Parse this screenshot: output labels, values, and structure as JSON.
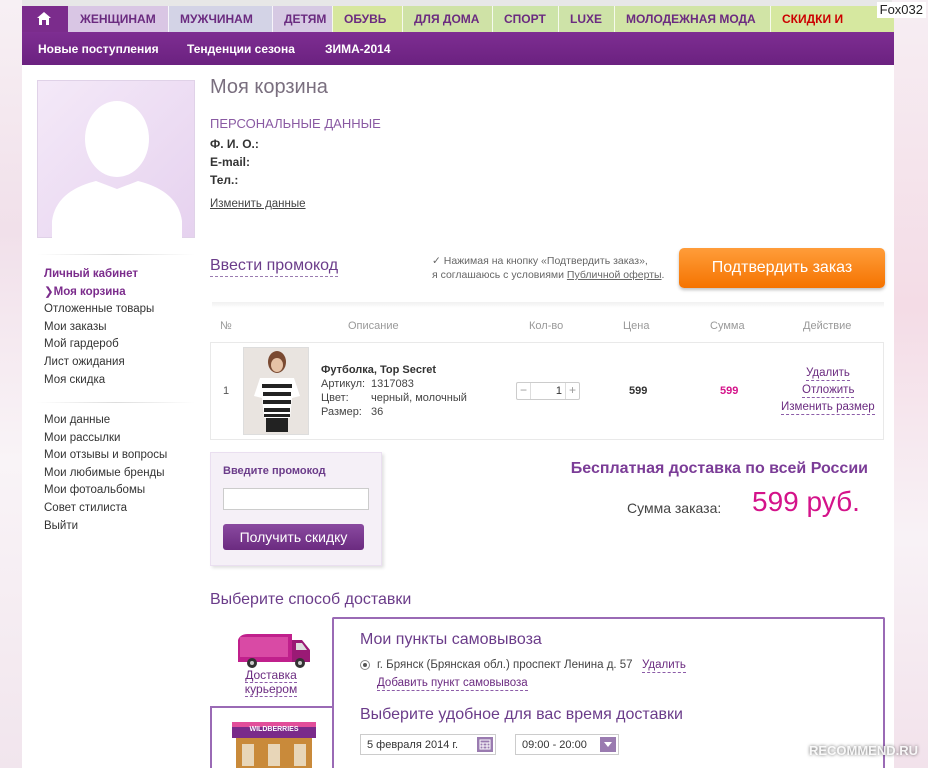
{
  "top_nav": {
    "tabs": [
      "ЖЕНЩИНАМ",
      "МУЖЧИНАМ",
      "ДЕТЯМ",
      "ОБУВЬ",
      "ДЛЯ ДОМА",
      "СПОРТ",
      "LUXE",
      "МОЛОДЕЖНАЯ МОДА",
      "СКИДКИ И АКЦИИ"
    ]
  },
  "sub_nav": [
    "Новые поступления",
    "Тенденции сезона",
    "ЗИМА-2014"
  ],
  "username": "Fox032",
  "sidebar": {
    "head": "Личный кабинет",
    "group1": [
      "Моя корзина",
      "Отложенные товары",
      "Мои заказы",
      "Мой гардероб",
      "Лист ожидания",
      "Моя скидка"
    ],
    "group2": [
      "Мои данные",
      "Мои рассылки",
      "Мои отзывы и вопросы",
      "Мои любимые бренды",
      "Мои фотоальбомы",
      "Совет стилиста",
      "Выйти"
    ]
  },
  "main": {
    "title": "Моя корзина",
    "personal_title": "ПЕРСОНАЛЬНЫЕ ДАННЫЕ",
    "fields": [
      "Ф. И. О.:",
      "E-mail:",
      "Тел.:"
    ],
    "edit_link": "Изменить данные",
    "promo_title": "Ввести промокод",
    "agree_line1": "Нажимая на кнопку «Подтвердить заказ»,",
    "agree_line2": "я соглашаюсь с условиями",
    "agree_link": "Публичной оферты",
    "agree_end": ".",
    "confirm_button": "Подтвердить заказ"
  },
  "table": {
    "headers": [
      "№",
      "Описание",
      "Кол-во",
      "Цена",
      "Сумма",
      "Действие"
    ],
    "row": {
      "num": "1",
      "name": "Футболка, Top Secret",
      "labels": [
        "Артикул:",
        "Цвет:",
        "Размер:"
      ],
      "values": [
        "1317083",
        "черный, молочный",
        "36"
      ],
      "qty": "1",
      "minus": "−",
      "plus": "+",
      "price": "599",
      "sum": "599",
      "actions": [
        "Удалить",
        "Отложить",
        "Изменить размер"
      ]
    }
  },
  "promo_box": {
    "label": "Введите промокод",
    "input_value": "",
    "button": "Получить скидку"
  },
  "summary": {
    "free_shipping": "Бесплатная доставка по всей России",
    "order_sum_label": "Сумма заказа:",
    "order_sum_value": "599 руб."
  },
  "delivery": {
    "title": "Выберите способ доставки",
    "courier_label_1": "Доставка",
    "courier_label_2": "курьером",
    "pickup_sign": "WILDBERRIES",
    "points_title": "Мои пункты самовывоза",
    "address": "г. Брянск (Брянская обл.) проспект Ленина д. 57",
    "delete_link": "Удалить",
    "add_point": "Добавить пункт самовывоза",
    "time_title": "Выберите удобное для вас время доставки",
    "date_value": "5 февраля 2014 г.",
    "time_value": "09:00 - 20:00"
  },
  "watermark": "RECOMMEND.RU",
  "colors": {
    "brand": "#7b2c8c",
    "accent_orange": "#f57300",
    "price_pink": "#d4138a"
  }
}
